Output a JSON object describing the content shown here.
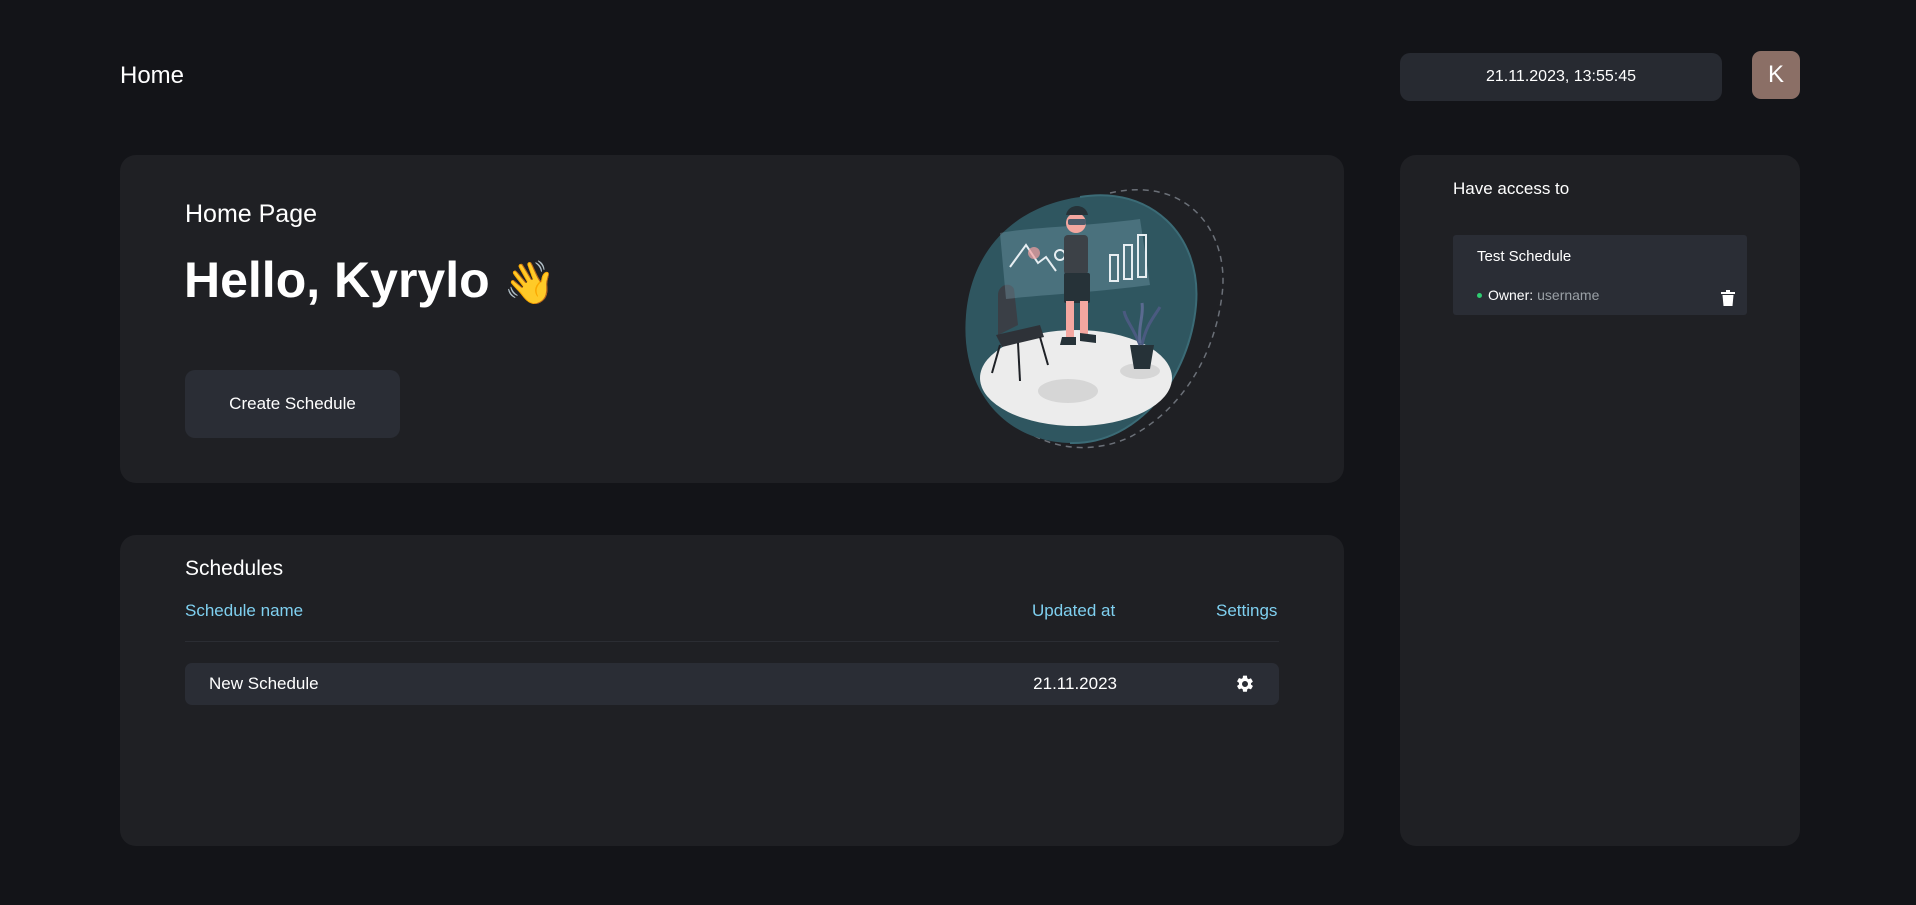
{
  "header": {
    "title": "Home",
    "datetime": "21.11.2023, 13:55:45",
    "avatar_initial": "K"
  },
  "hero": {
    "subtitle": "Home Page",
    "greeting": "Hello, Kyrylo",
    "wave_emoji": "👋",
    "create_button_label": "Create Schedule"
  },
  "schedules": {
    "title": "Schedules",
    "columns": {
      "name": "Schedule name",
      "updated": "Updated at",
      "settings": "Settings"
    },
    "rows": [
      {
        "name": "New Schedule",
        "updated": "21.11.2023",
        "settings_icon": "gear-icon"
      }
    ]
  },
  "access": {
    "title": "Have access to",
    "items": [
      {
        "name": "Test Schedule",
        "owner_label": "Owner:",
        "owner_value": "username",
        "action_icon": "trash-icon"
      }
    ]
  },
  "colors": {
    "background": "#131418",
    "card": "#1f2024",
    "accent_text": "#7fd0f0",
    "status_dot": "#2ecc71",
    "avatar": "#8b6f66"
  }
}
